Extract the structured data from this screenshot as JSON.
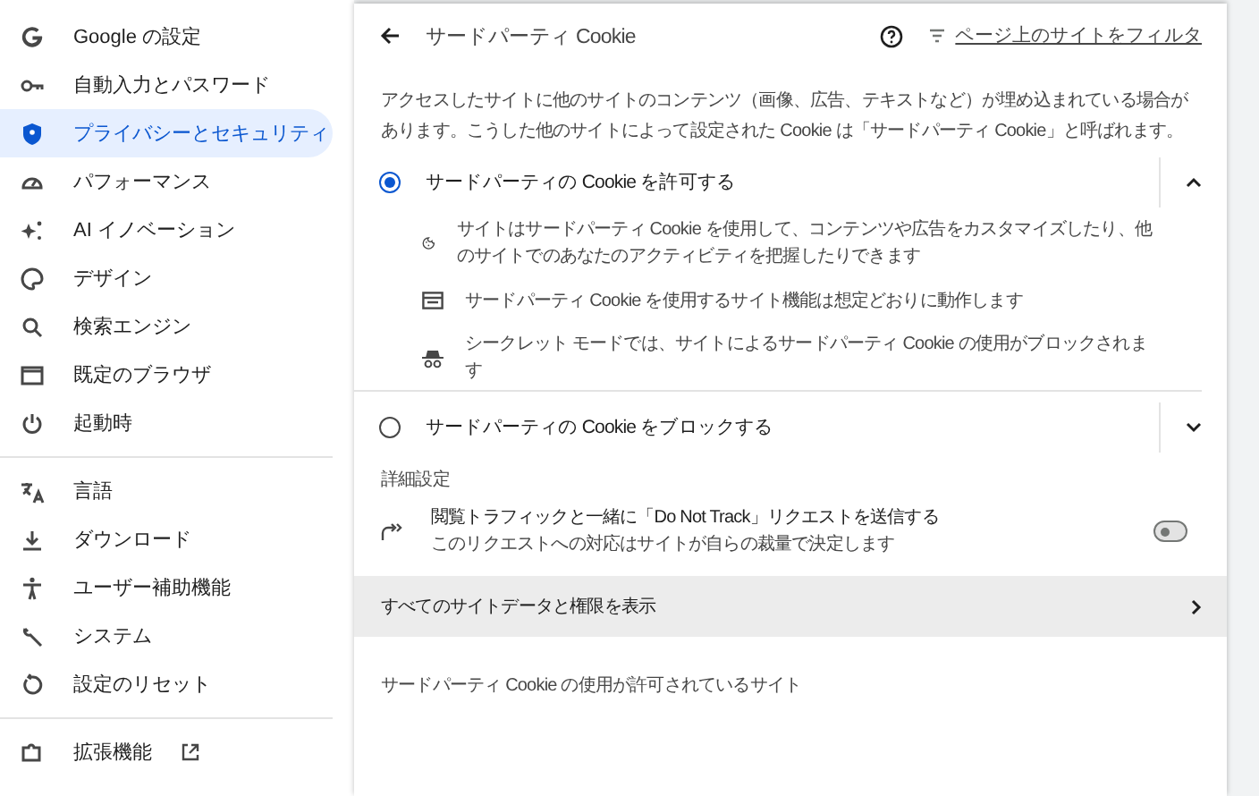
{
  "sidebar": {
    "groups": [
      [
        {
          "label": "Google の設定",
          "selected": false
        },
        {
          "label": "自動入力とパスワード",
          "selected": false
        },
        {
          "label": "プライバシーとセキュリティ",
          "selected": true
        },
        {
          "label": "パフォーマンス",
          "selected": false
        },
        {
          "label": "AI イノベーション",
          "selected": false
        },
        {
          "label": "デザイン",
          "selected": false
        },
        {
          "label": "検索エンジン",
          "selected": false
        },
        {
          "label": "既定のブラウザ",
          "selected": false
        },
        {
          "label": "起動時",
          "selected": false
        }
      ],
      [
        {
          "label": "言語",
          "selected": false
        },
        {
          "label": "ダウンロード",
          "selected": false
        },
        {
          "label": "ユーザー補助機能",
          "selected": false
        },
        {
          "label": "システム",
          "selected": false
        },
        {
          "label": "設定のリセット",
          "selected": false
        }
      ],
      [
        {
          "label": "拡張機能",
          "selected": false,
          "external": true
        }
      ]
    ]
  },
  "page": {
    "title": "サードパーティ Cookie",
    "filter_link": "ページ上のサイトをフィルタ",
    "description": "アクセスしたサイトに他のサイトのコンテンツ（画像、広告、テキストなど）が埋め込まれている場合があります。こうした他のサイトによって設定された Cookie は「サードパーティ Cookie」と呼ばれます。",
    "options": [
      {
        "label": "サードパーティの Cookie を許可する",
        "selected": true,
        "expanded": true,
        "details": [
          "サイトはサードパーティ Cookie を使用して、コンテンツや広告をカスタマイズしたり、他のサイトでのあなたのアクティビティを把握したりできます",
          "サードパーティ Cookie を使用するサイト機能は想定どおりに動作します",
          "シークレット モードでは、サイトによるサードパーティ Cookie の使用がブロックされます"
        ]
      },
      {
        "label": "サードパーティの Cookie をブロックする",
        "selected": false,
        "expanded": false
      }
    ],
    "advanced_heading": "詳細設定",
    "do_not_track": {
      "title": "閲覧トラフィックと一緒に「Do Not Track」リクエストを送信する",
      "subtitle": "このリクエストへの対応はサイトが自らの裁量で決定します",
      "on": false
    },
    "all_site_data_link": "すべてのサイトデータと権限を表示",
    "allowed_sites_heading": "サードパーティ Cookie の使用が許可されているサイト"
  }
}
